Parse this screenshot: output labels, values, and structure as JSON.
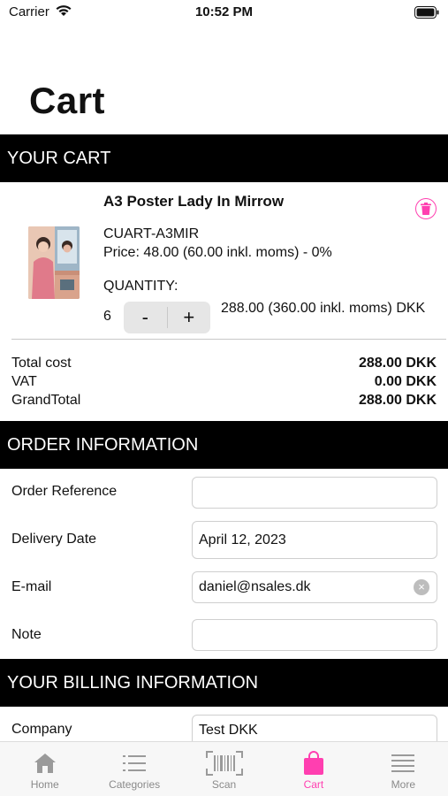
{
  "status": {
    "carrier": "Carrier",
    "time": "10:52 PM"
  },
  "page": {
    "title": "Cart"
  },
  "sections": {
    "cart": "YOUR CART",
    "order": "ORDER INFORMATION",
    "billing": "YOUR BILLING INFORMATION"
  },
  "item": {
    "name": "A3 Poster Lady In Mirrow",
    "sku": "CUART-A3MIR",
    "price": "Price: 48.00 (60.00 inkl. moms) - 0%",
    "quantity_label": "QUANTITY:",
    "quantity": "6",
    "minus": "-",
    "plus": "+",
    "line_total": "288.00 (360.00 inkl. moms) DKK"
  },
  "summary": {
    "total_label": "Total cost",
    "total_value": "288.00 DKK",
    "vat_label": "VAT",
    "vat_value": "0.00 DKK",
    "grand_label": "GrandTotal",
    "grand_value": "288.00 DKK"
  },
  "order_form": {
    "reference_label": "Order Reference",
    "reference_value": "",
    "delivery_label": "Delivery Date",
    "delivery_value": "April 12, 2023",
    "email_label": "E-mail",
    "email_value": "daniel@nsales.dk",
    "note_label": "Note",
    "note_value": ""
  },
  "billing_form": {
    "company_label": "Company",
    "company_value": "Test DKK"
  },
  "tabs": [
    {
      "label": "Home",
      "icon": "home-icon"
    },
    {
      "label": "Categories",
      "icon": "list-icon"
    },
    {
      "label": "Scan",
      "icon": "barcode-icon"
    },
    {
      "label": "Cart",
      "icon": "shopping-bag-icon",
      "active": true
    },
    {
      "label": "More",
      "icon": "menu-icon"
    }
  ],
  "colors": {
    "accent": "#ff3fb0",
    "header_bg": "#000000"
  }
}
